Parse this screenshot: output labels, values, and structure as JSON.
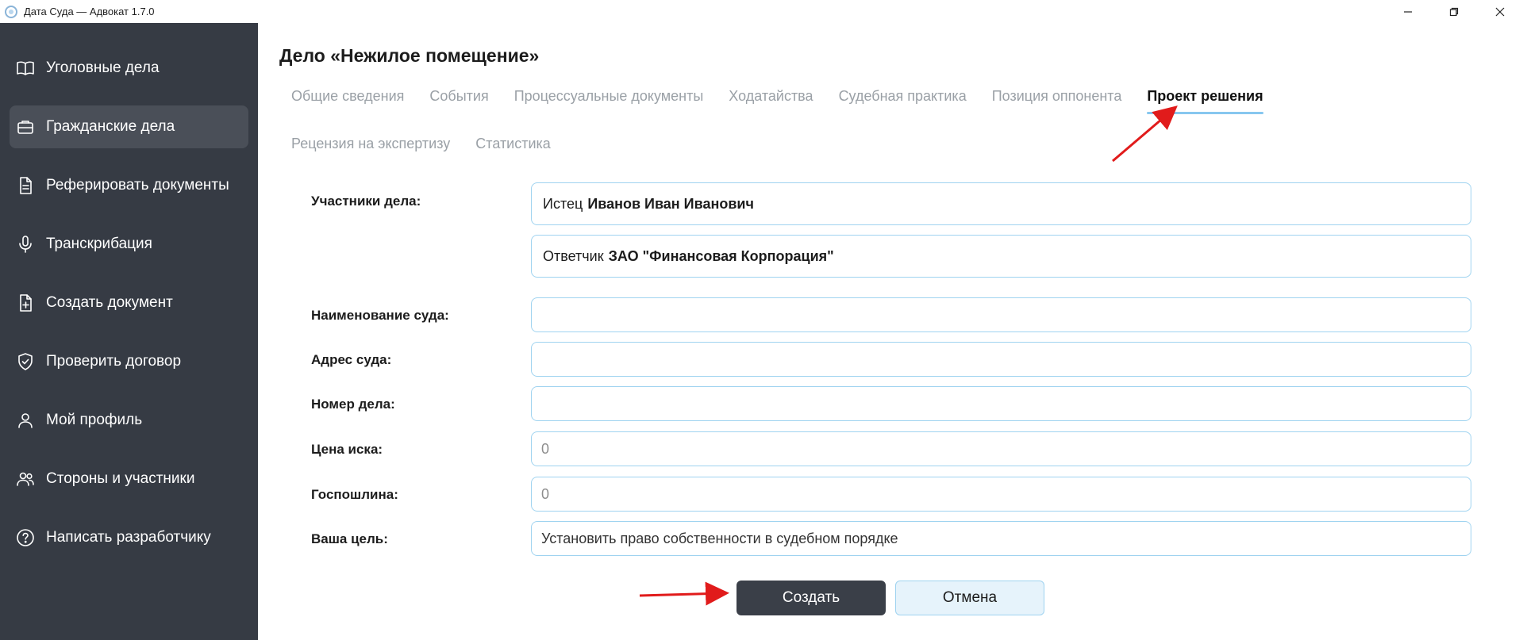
{
  "window": {
    "title": "Дата Суда — Адвокат 1.7.0",
    "controls": [
      "minimize-icon",
      "restore-icon",
      "close-icon"
    ]
  },
  "sidebar": {
    "items": [
      {
        "label": "Уголовные дела",
        "icon": "book-open-icon",
        "active": false
      },
      {
        "label": "Гражданские дела",
        "icon": "briefcase-icon",
        "active": true
      },
      {
        "label": "Реферировать документы",
        "icon": "document-text-icon",
        "active": false
      },
      {
        "label": "Транскрибация",
        "icon": "microphone-icon",
        "active": false
      },
      {
        "label": "Создать документ",
        "icon": "file-plus-icon",
        "active": false
      },
      {
        "label": "Проверить договор",
        "icon": "shield-check-icon",
        "active": false
      },
      {
        "label": "Мой профиль",
        "icon": "user-icon",
        "active": false
      },
      {
        "label": "Стороны и участники",
        "icon": "users-icon",
        "active": false
      },
      {
        "label": "Написать разработчику",
        "icon": "help-circle-icon",
        "active": false
      }
    ]
  },
  "main": {
    "case_title": "Дело «Нежилое помещение»",
    "tabs_row1": [
      {
        "label": "Общие сведения",
        "active": false
      },
      {
        "label": "События",
        "active": false
      },
      {
        "label": "Процессуальные документы",
        "active": false
      },
      {
        "label": "Ходатайства",
        "active": false
      },
      {
        "label": "Судебная практика",
        "active": false
      },
      {
        "label": "Позиция оппонента",
        "active": false
      },
      {
        "label": "Проект решения",
        "active": true
      }
    ],
    "tabs_row2": [
      {
        "label": "Рецензия на экспертизу",
        "active": false
      },
      {
        "label": "Статистика",
        "active": false
      }
    ],
    "form": {
      "participants_label": "Участники дела:",
      "plaintiff": {
        "role": "Истец",
        "name": "Иванов Иван Иванович"
      },
      "defendant": {
        "role": "Ответчик",
        "name": "ЗАО \"Финансовая Корпорация\""
      },
      "court_name_label": "Наименование суда:",
      "court_name_value": "",
      "court_address_label": "Адрес суда:",
      "court_address_value": "",
      "case_number_label": "Номер дела:",
      "case_number_value": "",
      "claim_price_label": "Цена иска:",
      "claim_price_placeholder": "0",
      "state_fee_label": "Госпошлина:",
      "state_fee_placeholder": "0",
      "goal_label": "Ваша цель:",
      "goal_value": "Установить право собственности в судебном порядке"
    },
    "buttons": {
      "create": "Создать",
      "cancel": "Отмена"
    }
  },
  "colors": {
    "sidebar_bg": "#363b44",
    "sidebar_active": "#4a4f58",
    "tab_underline": "#87c7ef",
    "field_border": "#9fd3f0",
    "create_button": "#3a3f48",
    "cancel_button": "#e6f3fb",
    "annotation_arrow": "#e11b1b"
  }
}
